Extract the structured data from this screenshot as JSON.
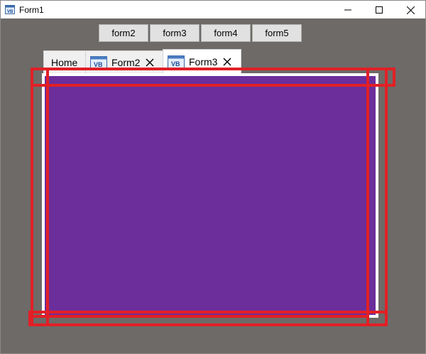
{
  "window": {
    "title": "Form1",
    "icon": "vb-form-icon",
    "controls": {
      "minimize": "minimize-icon",
      "maximize": "maximize-icon",
      "close": "close-icon"
    }
  },
  "toolbar": {
    "buttons": [
      "form2",
      "form3",
      "form4",
      "form5"
    ]
  },
  "tabs": [
    {
      "label": "Home",
      "icon": null,
      "closable": false,
      "active": false
    },
    {
      "label": "Form2",
      "icon": "vb-icon",
      "closable": true,
      "active": false
    },
    {
      "label": "Form3",
      "icon": "vb-icon",
      "closable": true,
      "active": true
    }
  ],
  "colors": {
    "client_background": "#6d6a67",
    "panel_fill": "#6b2e9b",
    "annotation_red": "#e21f26"
  }
}
